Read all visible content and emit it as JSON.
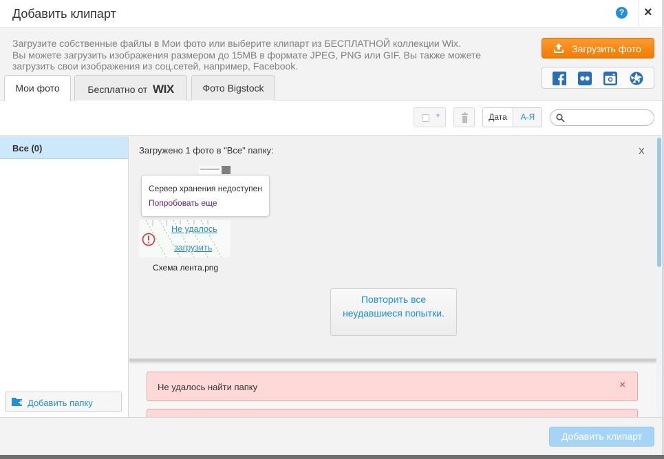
{
  "dialog": {
    "title": "Добавить клипарт",
    "help_label": "?",
    "close_label": "×"
  },
  "header": {
    "intro_line1": "Загрузите собственные файлы в Мои фото или выберите клипарт из БЕСПЛАТНОЙ коллекции Wix.",
    "intro_line2": "Вы можете загрузить изображения размером до 15MB в формате JPEG, PNG или GIF. Вы также можете",
    "intro_line3": "загрузить свои изображения из соц.сетей, например, Facebook.",
    "upload_button": "Загрузить фото",
    "social_icons": [
      "facebook-icon",
      "flickr-icon",
      "instagram-icon",
      "picasa-icon"
    ]
  },
  "tabs": [
    {
      "label": "Мои фото",
      "active": true
    },
    {
      "label": "Бесплатно от",
      "logo": "WIX",
      "active": false
    },
    {
      "label": "Фото Bigstock",
      "active": false
    }
  ],
  "toolbar": {
    "sort_date": "Дата",
    "sort_az": "А-Я",
    "search_placeholder": ""
  },
  "sidebar": {
    "items": [
      {
        "label": "Все (0)",
        "selected": true
      }
    ],
    "add_folder": "Добавить папку"
  },
  "upload_panel": {
    "title": "Загружено 1 фото в \"Все\" папку:",
    "close": "X",
    "tooltip_message": "Сервер хранения недоступен",
    "tooltip_retry": "Попробовать еще",
    "fail_line1": "Не удалось",
    "fail_line2": "загрузить",
    "file_name": "Схема лента.png",
    "retry_all": "Повторить все неудавшиеся попытки."
  },
  "alerts": [
    {
      "message": "Не удалось найти папку",
      "close": "×"
    }
  ],
  "footer": {
    "add_clipart": "Добавить клипарт"
  },
  "colors": {
    "accent_blue": "#1f90db",
    "orange": "#f27b00",
    "alert_bg": "#ffd8d8",
    "selected_bg": "#cde7fb"
  }
}
